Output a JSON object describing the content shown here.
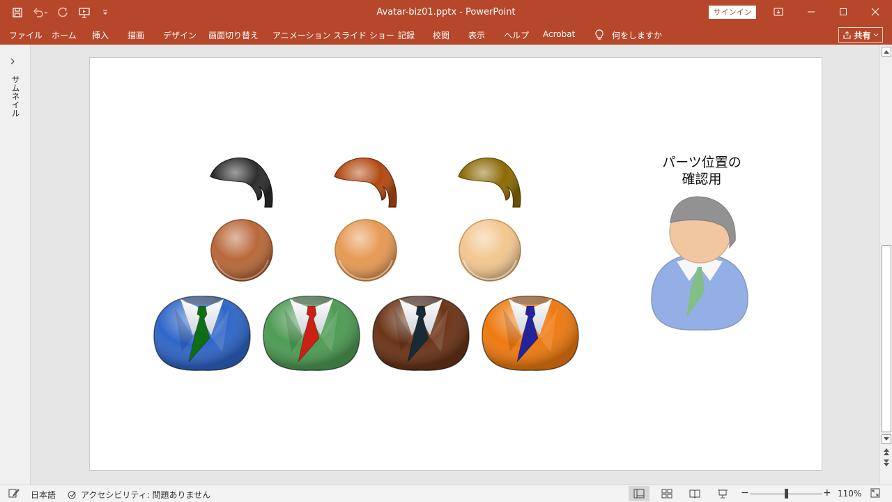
{
  "window": {
    "title": "Avatar-biz01.pptx  -  PowerPoint",
    "signin_label": "サインイン"
  },
  "ribbon": {
    "tabs": [
      "ファイル",
      "ホーム",
      "挿入",
      "描画",
      "デザイン",
      "画面切り替え",
      "アニメーション",
      "スライド ショー",
      "記録",
      "校閲",
      "表示",
      "ヘルプ",
      "Acrobat"
    ],
    "tell_me": "何をしますか",
    "share_label": "共有"
  },
  "thumbnail_pane": {
    "label": "サムネイル"
  },
  "slide": {
    "check_text_line1": "パーツ位置の",
    "check_text_line2": "確認用",
    "hair_colors": [
      "#2e2e2e",
      "#b24a12",
      "#8c6a05"
    ],
    "face_colors": [
      "#b9683a",
      "#e69a55",
      "#f2c790"
    ],
    "suit_colors": [
      "#2f66c8",
      "#4e9c54",
      "#6b3418",
      "#ee7a10"
    ],
    "tie_colors": [
      "#0f6e14",
      "#cc1f16",
      "#172a36",
      "#22249c"
    ]
  },
  "statusbar": {
    "language": "日本語",
    "accessibility": "アクセシビリティ: 問題ありません",
    "zoom_level": "110%"
  },
  "colors": {
    "accent": "#b7472a"
  }
}
